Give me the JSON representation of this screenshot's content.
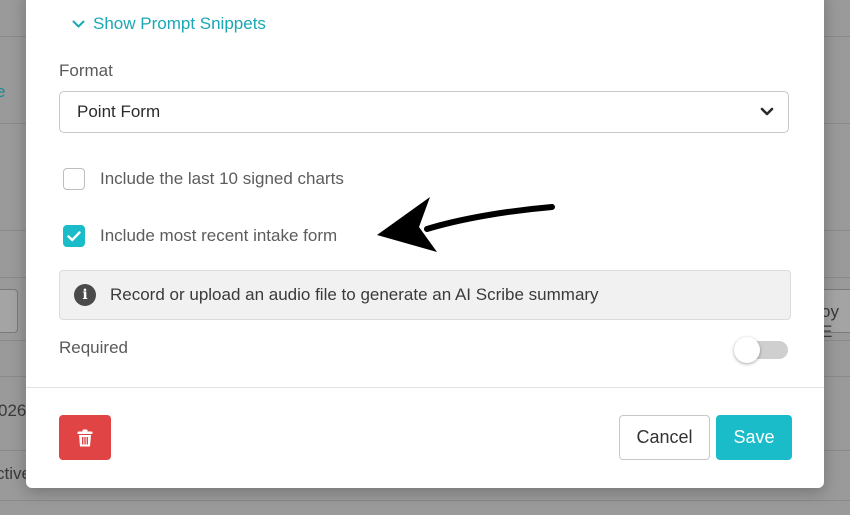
{
  "background": {
    "fragments": [
      "e",
      "026",
      "ctive",
      "oy E"
    ]
  },
  "modal": {
    "snippets_toggle_label": "Show Prompt Snippets",
    "format": {
      "label": "Format",
      "selected": "Point Form"
    },
    "options": [
      {
        "label": "Include the last 10 signed charts",
        "checked": false
      },
      {
        "label": "Include most recent intake form",
        "checked": true
      }
    ],
    "info": {
      "text": "Record or upload an audio file to generate an AI Scribe summary"
    },
    "required": {
      "label": "Required",
      "on": false
    },
    "footer": {
      "cancel_label": "Cancel",
      "save_label": "Save"
    }
  },
  "colors": {
    "accent": "#19bcc8",
    "danger": "#e04444"
  }
}
